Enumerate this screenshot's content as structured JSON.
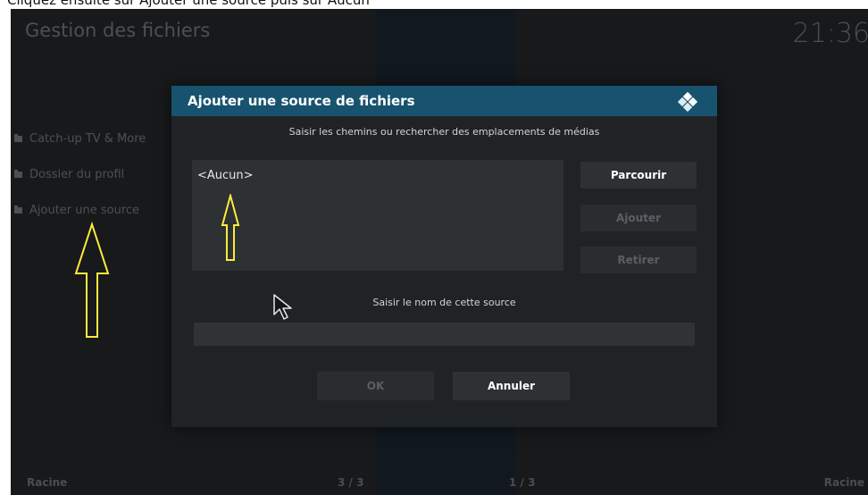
{
  "caption": {
    "text": "Cliquez ensuite sur Ajouter une source puis sur Aucun"
  },
  "app": {
    "title": "Gestion des fichiers",
    "clock": "21:36"
  },
  "sidebar": {
    "items": [
      {
        "label": "Catch-up TV & More",
        "icon": "folder-icon"
      },
      {
        "label": "Dossier du profil",
        "icon": "folder-icon"
      },
      {
        "label": "Ajouter une source",
        "icon": "folder-icon"
      }
    ]
  },
  "dialog": {
    "title": "Ajouter une source de fichiers",
    "logo_icon": "kodi-logo-icon",
    "path_instruction": "Saisir les chemins ou rechercher des emplacements de médias",
    "paths": [
      {
        "label": "<Aucun>"
      }
    ],
    "buttons": {
      "browse": "Parcourir",
      "add": "Ajouter",
      "remove": "Retirer",
      "ok": "OK",
      "cancel": "Annuler"
    },
    "name_label": "Saisir le nom de cette source",
    "name_value": ""
  },
  "footer": {
    "left": "Racine",
    "left_page": "3 / 3",
    "right_page": "1 / 3",
    "right": "Racine"
  },
  "annotations": {
    "arrow_color": "#ffeb3b",
    "targets": [
      "Ajouter une source",
      "<Aucun>"
    ]
  },
  "colors": {
    "background": "#17191b",
    "dialog_header": "#17536f",
    "dialog_body": "#202325",
    "control": "#2d3134"
  }
}
